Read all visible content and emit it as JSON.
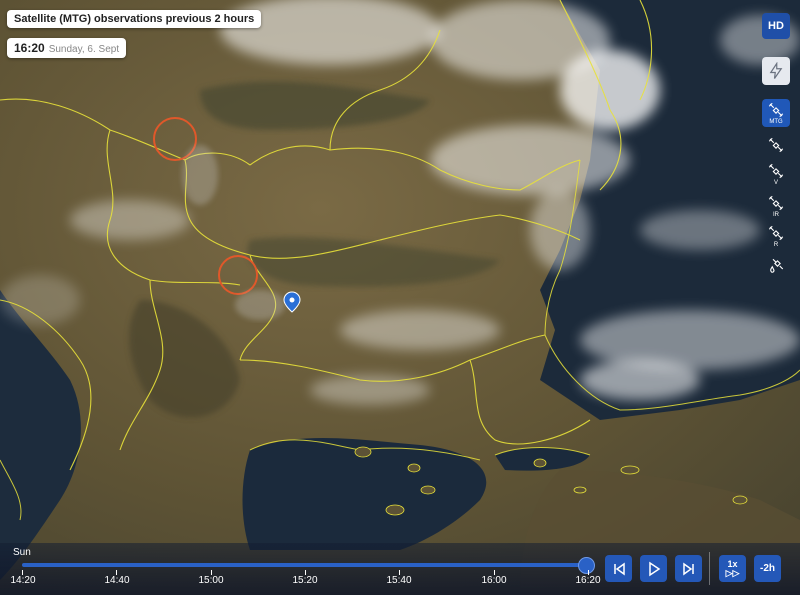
{
  "title": "Satellite (MTG) observations previous 2 hours",
  "time": {
    "clock": "16:20",
    "date": "Sunday, 6. Sept"
  },
  "hd_label": "HD",
  "side_layers": [
    {
      "icon": "lightning-icon",
      "label": ""
    },
    {
      "icon": "satellite-icon",
      "label": "MTG"
    },
    {
      "icon": "satellite-icon",
      "label": ""
    },
    {
      "icon": "satellite-icon",
      "label": "V"
    },
    {
      "icon": "satellite-icon",
      "label": "IR"
    },
    {
      "icon": "satellite-icon",
      "label": "R"
    },
    {
      "icon": "satellite-drop-icon",
      "label": ""
    }
  ],
  "timeline": {
    "day": "Sun",
    "labels": [
      "14:20",
      "14:40",
      "15:00",
      "15:20",
      "15:40",
      "16:00",
      "16:20"
    ],
    "progress": 1.0
  },
  "controls": {
    "speed_top": "1x",
    "speed_bottom": "▷▷",
    "range": "-2h"
  },
  "colors": {
    "accent": "#2458b8",
    "borders": "#e8e23a",
    "sea": "#1c2a3a",
    "land": "#6a5a3a",
    "fire_marker": "#e0582a"
  }
}
